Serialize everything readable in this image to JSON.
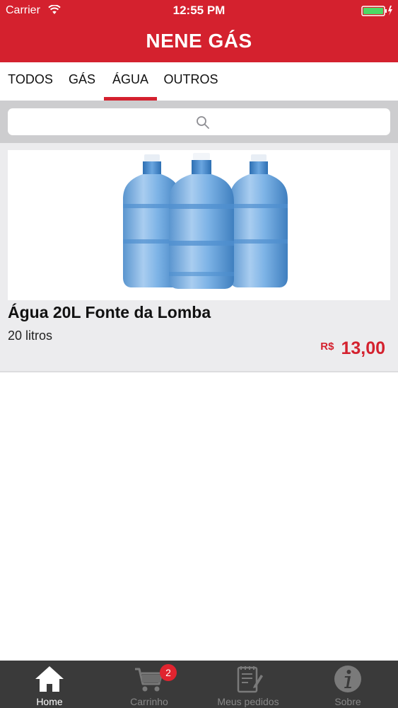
{
  "status_bar": {
    "carrier": "Carrier",
    "time": "12:55 PM"
  },
  "header": {
    "title": "NENE GÁS",
    "background_color": "#d4212e"
  },
  "tabs": [
    {
      "label": "TODOS",
      "selected": false
    },
    {
      "label": "GÁS",
      "selected": false
    },
    {
      "label": "ÁGUA",
      "selected": true
    },
    {
      "label": "OUTROS",
      "selected": false
    }
  ],
  "search": {
    "placeholder": "",
    "icon": "search-icon"
  },
  "products": [
    {
      "name": "Água 20L Fonte da Lomba",
      "description": "20 litros",
      "currency": "R$",
      "price": "13,00",
      "image": "water-gallon-bottles"
    }
  ],
  "bottom_nav": {
    "items": [
      {
        "label": "Home",
        "icon": "home-icon",
        "active": true
      },
      {
        "label": "Carrinho",
        "icon": "cart-icon",
        "active": false
      },
      {
        "label": "Meus pedidos",
        "icon": "orders-icon",
        "active": false
      },
      {
        "label": "Sobre",
        "icon": "info-icon",
        "active": false
      }
    ],
    "cart_badge": "2"
  },
  "colors": {
    "accent": "#d4212e",
    "nav_background": "#3a3a3a",
    "card_background": "#ececee"
  }
}
